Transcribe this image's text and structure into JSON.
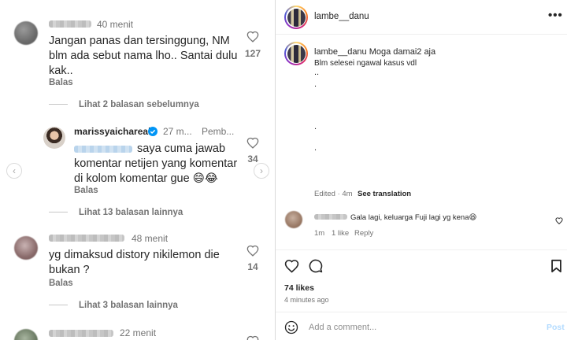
{
  "left": {
    "comments": [
      {
        "time": "40 menit",
        "text_lines": [
          "Jangan panas dan tersinggung, NM",
          "blm ada sebut nama lho.. Santai dulu",
          "kak.."
        ],
        "reply_label": "Balas",
        "likes": "127"
      },
      {
        "view_more": "Lihat 2 balasan sebelumnya"
      },
      {
        "username": "marissyaichareal",
        "time": "27 m...",
        "pinned": "Pemb...",
        "text_lines": [
          "saya cuma jawab",
          "komentar netijen yang komentar",
          "di kolom komentar gue 😄😂"
        ],
        "reply_label": "Balas",
        "likes": "34"
      },
      {
        "view_more": "Lihat 13 balasan lainnya"
      },
      {
        "time": "48 menit",
        "text_lines": [
          "yg dimaksud distory nikilemon die",
          "bukan ?"
        ],
        "reply_label": "Balas",
        "likes": "14"
      },
      {
        "view_more": "Lihat 3 balasan lainnya"
      },
      {
        "time": "22 menit"
      }
    ],
    "nav_prev": "‹",
    "nav_next": "›"
  },
  "right": {
    "header": {
      "username": "lambe__danu",
      "more_icon": "•••"
    },
    "caption": {
      "username": "lambe__danu",
      "text": "Moga damai2 aja",
      "line2": "Blm selesei ngawal kasus vdl",
      "dots": [
        "..",
        ".",
        ".",
        "."
      ],
      "edited": "Edited · 4m",
      "see_translation": "See translation"
    },
    "comment": {
      "text": "Gala lagi, keluarga Fuji lagi yg kena😆",
      "time": "1m",
      "likes": "1 like",
      "reply": "Reply"
    },
    "actions": {
      "likes": "74 likes",
      "ago": "4 minutes ago"
    },
    "add_comment": {
      "placeholder": "Add a comment...",
      "post": "Post"
    }
  }
}
